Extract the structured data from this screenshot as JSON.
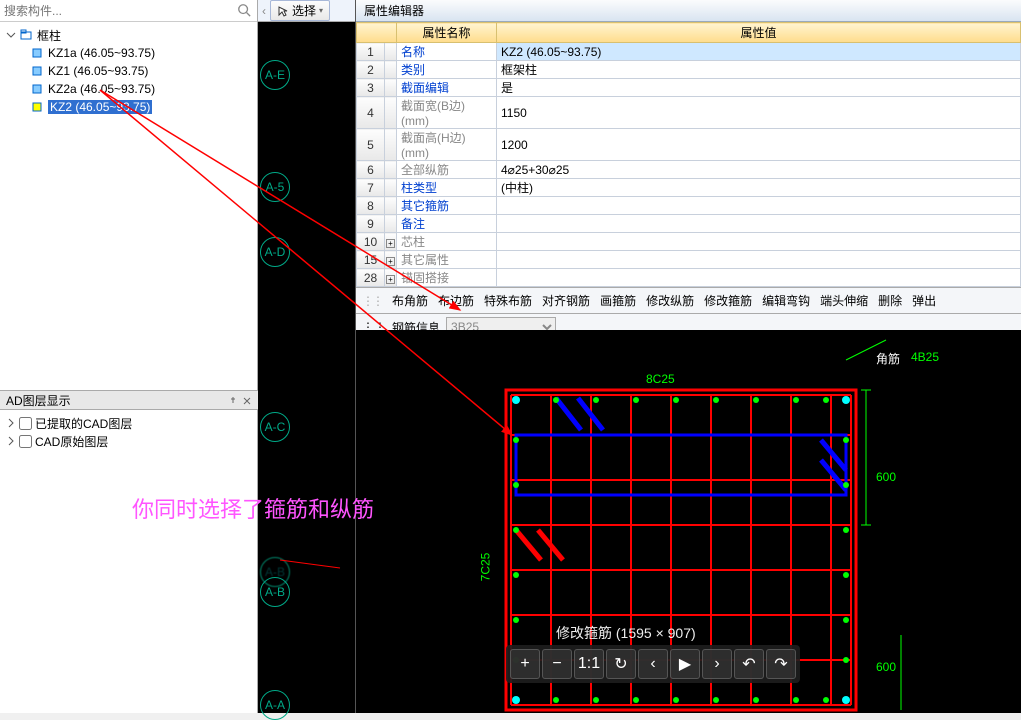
{
  "search": {
    "placeholder": "搜索构件..."
  },
  "tree": {
    "root": "框柱",
    "items": [
      {
        "label": "KZ1a (46.05~93.75)"
      },
      {
        "label": "KZ1 (46.05~93.75)"
      },
      {
        "label": "KZ2a (46.05~93.75)"
      },
      {
        "label": "KZ2 (46.05~93.75)",
        "selected": true
      }
    ]
  },
  "cad_panel": {
    "title": "AD图层显示",
    "items": [
      "已提取的CAD图层",
      "CAD原始图层"
    ]
  },
  "mid": {
    "select_label": "选择"
  },
  "axis_labels": [
    "A-E",
    "A-5",
    "A-D",
    "A-C",
    "A-B",
    "A-B",
    "A-A"
  ],
  "property_editor": {
    "title": "属性编辑器",
    "col_name": "属性名称",
    "col_value": "属性值",
    "rows": [
      {
        "n": "1",
        "name": "名称",
        "value": "KZ2 (46.05~93.75)",
        "hl": true
      },
      {
        "n": "2",
        "name": "类别",
        "value": "框架柱"
      },
      {
        "n": "3",
        "name": "截面编辑",
        "value": "是"
      },
      {
        "n": "4",
        "name": "截面宽(B边)(mm)",
        "value": "1150",
        "gray": true
      },
      {
        "n": "5",
        "name": "截面高(H边)(mm)",
        "value": "1200",
        "gray": true
      },
      {
        "n": "6",
        "name": "全部纵筋",
        "value": "4⌀25+30⌀25",
        "gray": true
      },
      {
        "n": "7",
        "name": "柱类型",
        "value": "(中柱)"
      },
      {
        "n": "8",
        "name": "其它箍筋",
        "value": ""
      },
      {
        "n": "9",
        "name": "备注",
        "value": ""
      },
      {
        "n": "10",
        "name": "芯柱",
        "value": "",
        "plus": true,
        "gray": true
      },
      {
        "n": "15",
        "name": "其它属性",
        "value": "",
        "plus": true,
        "gray": true
      },
      {
        "n": "28",
        "name": "锚固搭接",
        "value": "",
        "plus": true,
        "gray": true
      }
    ]
  },
  "toolbar": {
    "items": [
      "布角筋",
      "布边筋",
      "特殊布筋",
      "对齐钢筋",
      "画箍筋",
      "修改纵筋",
      "修改箍筋",
      "编辑弯钩",
      "端头伸缩",
      "删除",
      "弹出"
    ],
    "rebar_label": "钢筋信息",
    "rebar_value": "3B25"
  },
  "section": {
    "corner_label": "角筋",
    "corner_value": "4B25",
    "top_label": "8C25",
    "left_label": "7C25",
    "dim_600a": "600",
    "dim_600b": "600"
  },
  "annotation": {
    "text": "你同时选择了箍筋和纵筋"
  },
  "viewer": {
    "caption": "修改箍筋 (1595 × 907)"
  },
  "chart_data": {
    "type": "table",
    "title": "属性编辑器",
    "columns": [
      "属性名称",
      "属性值"
    ],
    "rows": [
      [
        "名称",
        "KZ2 (46.05~93.75)"
      ],
      [
        "类别",
        "框架柱"
      ],
      [
        "截面编辑",
        "是"
      ],
      [
        "截面宽(B边)(mm)",
        "1150"
      ],
      [
        "截面高(H边)(mm)",
        "1200"
      ],
      [
        "全部纵筋",
        "4⌀25+30⌀25"
      ],
      [
        "柱类型",
        "(中柱)"
      ],
      [
        "其它箍筋",
        ""
      ],
      [
        "备注",
        ""
      ],
      [
        "芯柱",
        ""
      ],
      [
        "其它属性",
        ""
      ],
      [
        "锚固搭接",
        ""
      ]
    ]
  }
}
